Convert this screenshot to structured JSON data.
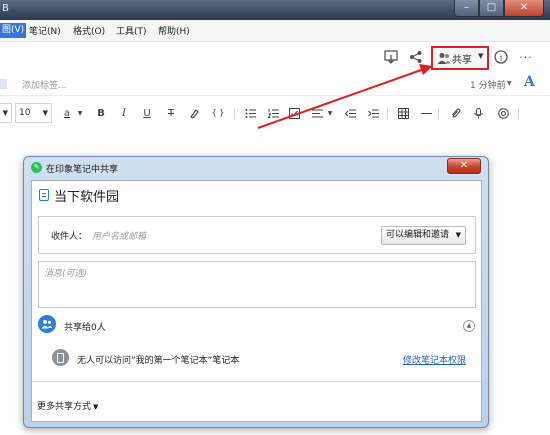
{
  "window": {
    "title_fragment": "B",
    "minimize": "–",
    "maximize": "□",
    "close": "✕"
  },
  "menu": {
    "view": "图(V)",
    "note": "笔记(N)",
    "format": "格式(O)",
    "tools": "工具(T)",
    "help": "帮助(H)"
  },
  "note_toolbar": {
    "share_label": "共享",
    "more": "···",
    "info": "i"
  },
  "tags": {
    "placeholder": "添加标签...",
    "last_edited": "1 分钟前",
    "font_icon": "A"
  },
  "format_toolbar": {
    "font_size": "10",
    "bold": "B",
    "italic": "I",
    "underline": "U",
    "strike": "T",
    "code": "{ }",
    "text_color_glyph": "a"
  },
  "share_dialog": {
    "window_title": "在印象笔记中共享",
    "close": "✕",
    "note_title": "当下软件园",
    "recipient_label": "收件人：",
    "recipient_placeholder": "用户名或邮箱",
    "permission": "可以编辑和邀请",
    "message_placeholder": "消息(可选)",
    "shared_with": "共享给0人",
    "access_note": "无人可以访问“我的第一个笔记本”笔记本",
    "change_permissions_link": "修改笔记本权限",
    "more_options": "更多共享方式"
  },
  "colors": {
    "highlight_red": "#e02020",
    "accent_blue": "#2a7de1",
    "evernote_green": "#2dbe60"
  }
}
